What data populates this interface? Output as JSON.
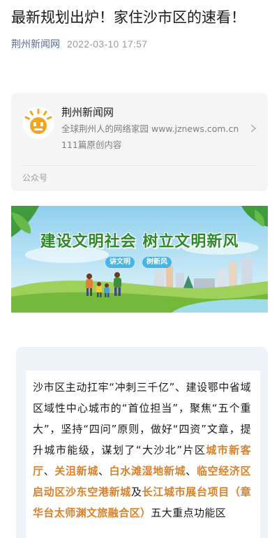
{
  "article": {
    "title": "最新规划出炉！家住沙市区的速看！",
    "source": "荆州新闻网",
    "date": "2022-03-10 17:57"
  },
  "account_card": {
    "name": "荆州新闻网",
    "description": "全球荆州人的网络家园 www.jznews.com.cn",
    "post_count": "111篇原创内容",
    "footer_label": "公众号"
  },
  "banner": {
    "slogan": "建设文明社会 树立文明新风",
    "tags": [
      "讲文明",
      "树新风"
    ],
    "colors": {
      "slogan": "#2d8a2a",
      "tag": "#47b4e3",
      "sky": "#8fd0ee",
      "grass": "#86c24a"
    }
  },
  "body": {
    "segments": [
      {
        "text": "沙市区主动扛牢“冲刺三千亿”、建设鄂中省域区域性中心城市的“首位担当”，聚焦“五个重大”，坚持“四问”原则，做好“四资”文章，提升城市能级，谋划了“大沙北”片区",
        "highlight": false
      },
      {
        "text": "城市新客厅",
        "highlight": true
      },
      {
        "text": "、",
        "highlight": false
      },
      {
        "text": "关沮新城",
        "highlight": true
      },
      {
        "text": "、",
        "highlight": false
      },
      {
        "text": "白水滩湿地新城",
        "highlight": true
      },
      {
        "text": "、",
        "highlight": false
      },
      {
        "text": "临空经济区启动区",
        "highlight": true
      },
      {
        "text": "沙东空港新城",
        "highlight": true
      },
      {
        "text": "及",
        "highlight": false
      },
      {
        "text": "长江城市展台项目（章华台太师渊文旅融合区）",
        "highlight": true
      },
      {
        "text": "五大重点功能区",
        "highlight": false
      }
    ],
    "highlight_color": "#d9822b"
  }
}
